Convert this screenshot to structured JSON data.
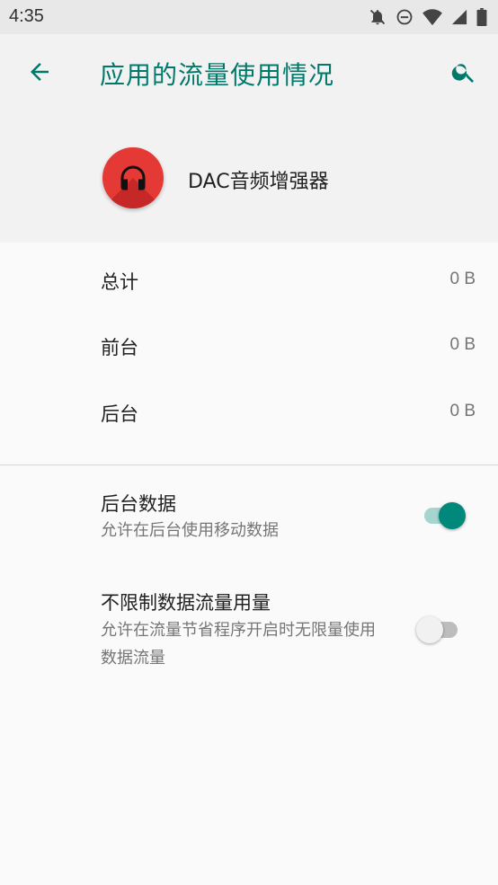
{
  "status_bar": {
    "time": "4:35"
  },
  "toolbar": {
    "title": "应用的流量使用情况"
  },
  "app": {
    "name": "DAC音频增强器"
  },
  "usage": [
    {
      "label": "总计",
      "value": "0 B"
    },
    {
      "label": "前台",
      "value": "0 B"
    },
    {
      "label": "后台",
      "value": "0 B"
    }
  ],
  "background_data": {
    "title": "后台数据",
    "summary": "允许在后台使用移动数据",
    "enabled": true
  },
  "unrestricted_data": {
    "title": "不限制数据流量用量",
    "summary": "允许在流量节省程序开启时无限量使用数据流量",
    "enabled": false
  },
  "colors": {
    "accent": "#00796b",
    "switch_on": "#00897b",
    "app_icon": "#e53935"
  }
}
